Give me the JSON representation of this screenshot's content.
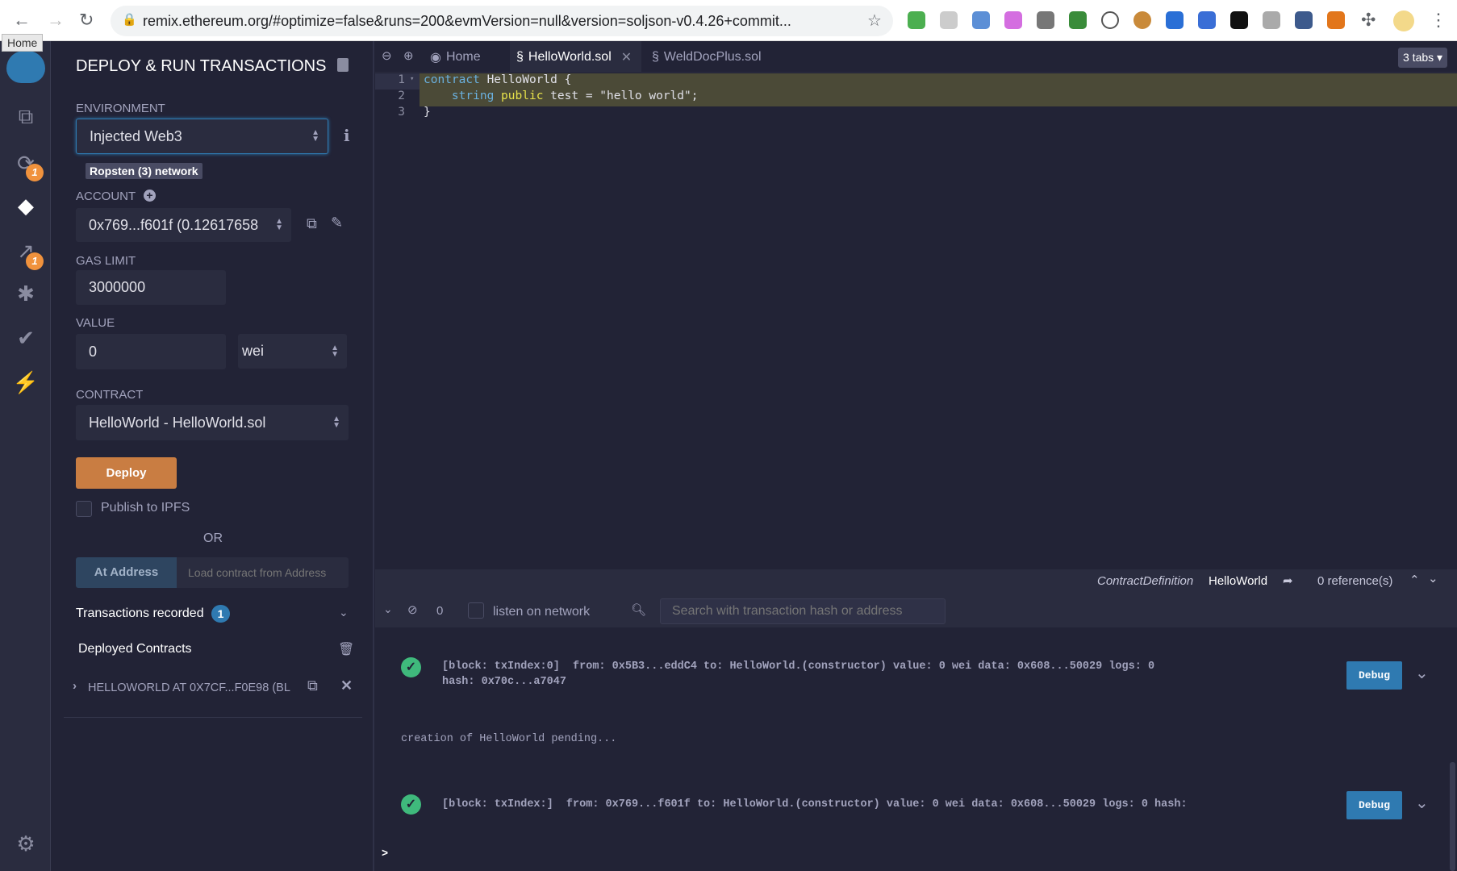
{
  "browser": {
    "url": "remix.ethereum.org/#optimize=false&runs=200&evmVersion=null&version=soljson-v0.4.26+commit...",
    "tooltip": "Home"
  },
  "iconbar": {
    "badges": [
      "1",
      "1"
    ]
  },
  "panel": {
    "title": "DEPLOY & RUN TRANSACTIONS",
    "environment_label": "ENVIRONMENT",
    "environment_value": "Injected Web3",
    "network": "Ropsten (3) network",
    "account_label": "ACCOUNT",
    "account_value": "0x769...f601f (0.12617658",
    "gas_label": "GAS LIMIT",
    "gas_value": "3000000",
    "value_label": "VALUE",
    "value_value": "0",
    "value_unit": "wei",
    "contract_label": "CONTRACT",
    "contract_value": "HelloWorld - HelloWorld.sol",
    "deploy": "Deploy",
    "publish": "Publish to IPFS",
    "or": "OR",
    "at_address": "At Address",
    "load_placeholder": "Load contract from Address",
    "tx_recorded": "Transactions recorded",
    "tx_count": "1",
    "deployed": "Deployed Contracts",
    "instance": "HELLOWORLD AT 0X7CF...F0E98 (BL"
  },
  "editor": {
    "tabs": [
      "Home",
      "HelloWorld.sol",
      "WeldDocPlus.sol"
    ],
    "tabs_count": "3 tabs",
    "lines": [
      "1",
      "2",
      "3"
    ],
    "status": {
      "kind": "ContractDefinition",
      "name": "HelloWorld",
      "refs": "0 reference(s)"
    }
  },
  "terminal": {
    "count": "0",
    "listen": "listen on network",
    "search_placeholder": "Search with transaction hash or address",
    "tx1_l1": "[block: txIndex:0]  from: 0x5B3...eddC4 to: HelloWorld.(constructor) value: 0 wei data: 0x608...50029 logs: 0",
    "tx1_l2": "hash: 0x70c...a7047",
    "pending": "creation of HelloWorld pending...",
    "tx2": "[block: txIndex:]  from: 0x769...f601f to: HelloWorld.(constructor) value: 0 wei data: 0x608...50029 logs: 0 hash:",
    "debug": "Debug",
    "prompt": ">"
  },
  "colors": {
    "accent": "#2f7ab1",
    "deploy": "#c97d42",
    "badge": "#f0923d",
    "success": "#3fb97c"
  }
}
